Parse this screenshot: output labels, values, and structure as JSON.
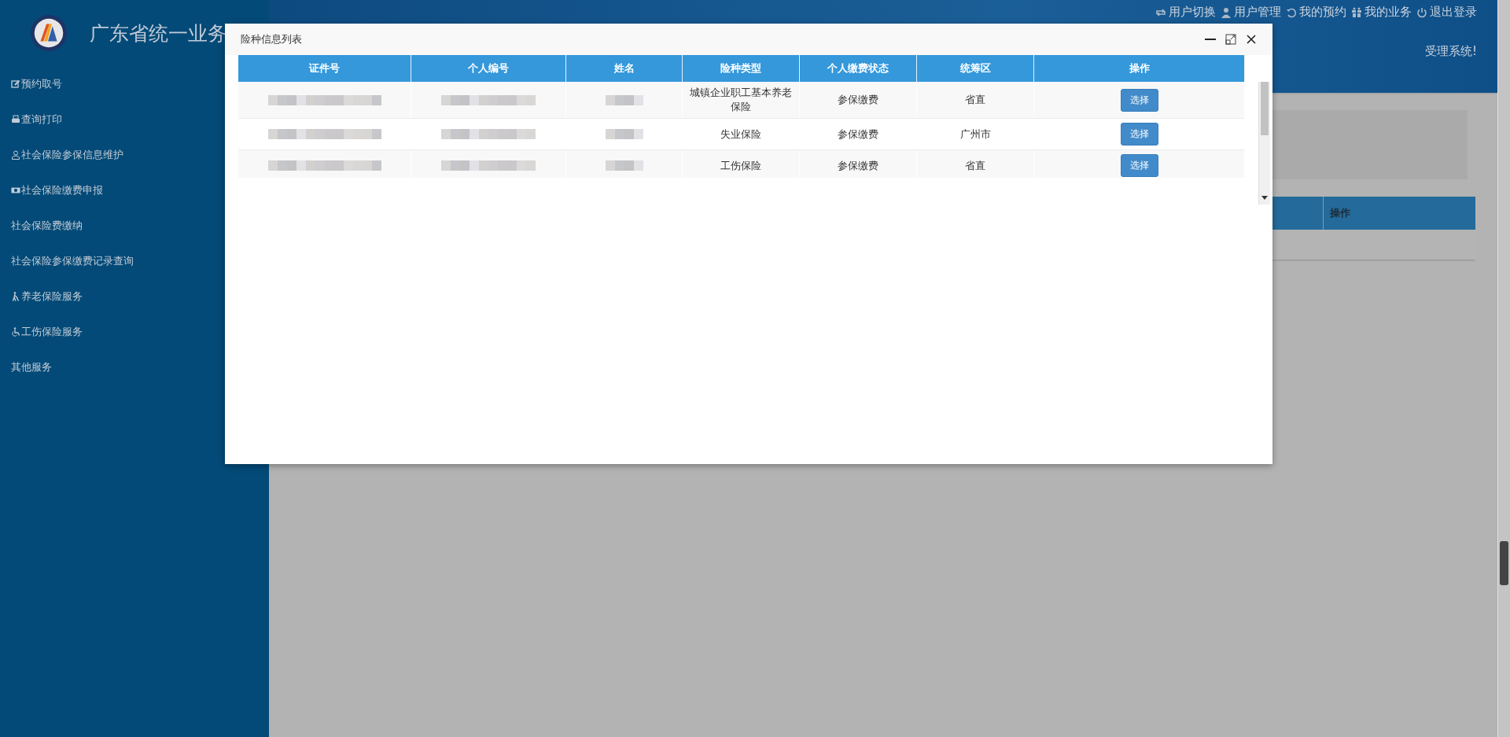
{
  "header": {
    "title": "广东省统一业务",
    "welcome": "受理系统!",
    "links": [
      {
        "label": "用户切换",
        "kind": "switch"
      },
      {
        "label": "用户管理",
        "kind": "user"
      },
      {
        "label": "我的预约",
        "kind": "history"
      },
      {
        "label": "我的业务",
        "kind": "grid"
      },
      {
        "label": "退出登录",
        "kind": "power"
      }
    ]
  },
  "sidebar": {
    "items": [
      {
        "label": "预约取号",
        "kind": "edit"
      },
      {
        "label": "查询打印",
        "kind": "print"
      },
      {
        "label": "社会保险参保信息维护",
        "kind": "user"
      },
      {
        "label": "社会保险缴费申报",
        "kind": "money"
      },
      {
        "label": "社会保险费缴纳",
        "kind": "plain"
      },
      {
        "label": "社会保险参保缴费记录查询",
        "kind": "plain"
      },
      {
        "label": "养老保险服务",
        "kind": "walker"
      },
      {
        "label": "工伤保险服务",
        "kind": "wheelchair"
      },
      {
        "label": "其他服务",
        "kind": "plain"
      }
    ]
  },
  "background_table": {
    "columns": [
      "操作"
    ]
  },
  "modal": {
    "title": "险种信息列表",
    "columns": [
      "证件号",
      "个人编号",
      "姓名",
      "险种类型",
      "个人缴费状态",
      "统筹区",
      "操作"
    ],
    "rows": [
      {
        "insurance_type": "城镇企业职工基本养老保险",
        "status": "参保缴费",
        "region": "省直",
        "action": "选择"
      },
      {
        "insurance_type": "失业保险",
        "status": "参保缴费",
        "region": "广州市",
        "action": "选择"
      },
      {
        "insurance_type": "工伤保险",
        "status": "参保缴费",
        "region": "省直",
        "action": "选择"
      }
    ]
  }
}
